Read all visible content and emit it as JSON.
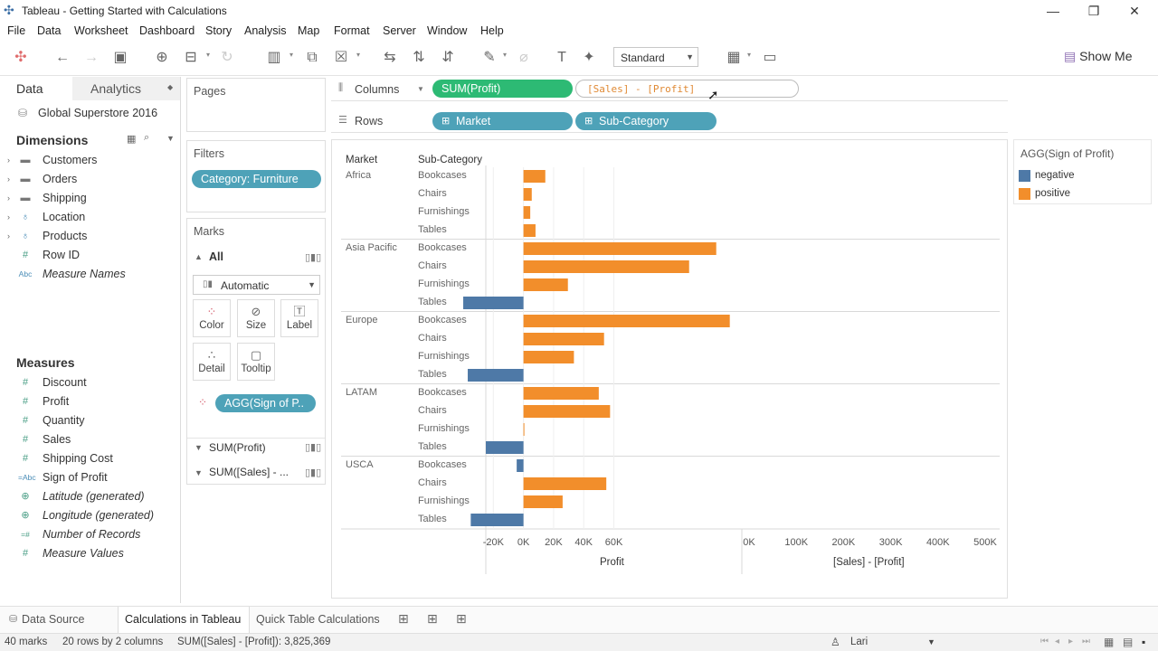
{
  "window": {
    "title": "Tableau - Getting Started with Calculations",
    "minimize": "—",
    "restore": "❐",
    "close": "✕"
  },
  "menu": [
    "File",
    "Data",
    "Worksheet",
    "Dashboard",
    "Story",
    "Analysis",
    "Map",
    "Format",
    "Server",
    "Window",
    "Help"
  ],
  "toolbar": {
    "fit_select": "Standard",
    "show_me": "Show Me"
  },
  "data_pane": {
    "tabs": {
      "data": "Data",
      "analytics": "Analytics"
    },
    "datasource": "Global Superstore 2016",
    "dimensions_title": "Dimensions",
    "dimensions": [
      {
        "label": "Customers",
        "icon": "folder-icon",
        "expand": "›"
      },
      {
        "label": "Orders",
        "icon": "folder-icon",
        "expand": "›"
      },
      {
        "label": "Shipping",
        "icon": "folder-icon",
        "expand": "›"
      },
      {
        "label": "Location",
        "icon": "hierarchy-icon",
        "expand": "›"
      },
      {
        "label": "Products",
        "icon": "hierarchy-icon",
        "expand": "›"
      },
      {
        "label": "Row ID",
        "icon": "hash-icon",
        "expand": ""
      },
      {
        "label": "Measure Names",
        "icon": "abc-icon",
        "expand": ""
      }
    ],
    "measures_title": "Measures",
    "measures": [
      {
        "label": "Discount",
        "icon": "hash-icon"
      },
      {
        "label": "Profit",
        "icon": "hash-icon"
      },
      {
        "label": "Quantity",
        "icon": "hash-icon"
      },
      {
        "label": "Sales",
        "icon": "hash-icon"
      },
      {
        "label": "Shipping Cost",
        "icon": "hash-icon"
      },
      {
        "label": "Sign of Profit",
        "icon": "calc-abc-icon"
      },
      {
        "label": "Latitude (generated)",
        "icon": "globe-icon"
      },
      {
        "label": "Longitude (generated)",
        "icon": "globe-icon"
      },
      {
        "label": "Number of Records",
        "icon": "calc-hash-icon"
      },
      {
        "label": "Measure Values",
        "icon": "hash-icon"
      }
    ]
  },
  "cards": {
    "pages_title": "Pages",
    "filters_title": "Filters",
    "filter_pill": "Category: Furniture",
    "marks_title": "Marks",
    "marks_all": "All",
    "mark_type": "Automatic",
    "mark_buttons": [
      {
        "label": "Color",
        "icon": "color-dots-icon"
      },
      {
        "label": "Size",
        "icon": "size-icon"
      },
      {
        "label": "Label",
        "icon": "label-icon"
      },
      {
        "label": "Detail",
        "icon": "detail-icon"
      },
      {
        "label": "Tooltip",
        "icon": "tooltip-icon"
      }
    ],
    "color_pill": "AGG(Sign of P..",
    "marks_sections": [
      "SUM(Profit)",
      "SUM([Sales] - ..."
    ]
  },
  "shelves": {
    "columns_label": "Columns",
    "rows_label": "Rows",
    "columns_pill": "SUM(Profit)",
    "columns_edit": "[Sales] - [Profit]",
    "rows_pills": [
      "Market",
      "Sub-Category"
    ]
  },
  "view": {
    "col_header_market": "Market",
    "col_header_subcat": "Sub-Category",
    "axis1_title": "Profit",
    "axis2_title": "[Sales] - [Profit]"
  },
  "chart_data": {
    "type": "bar",
    "markets": [
      "Africa",
      "Asia Pacific",
      "Europe",
      "LATAM",
      "USCA"
    ],
    "subcategories": [
      "Bookcases",
      "Chairs",
      "Furnishings",
      "Tables"
    ],
    "profit_series": {
      "name": "Profit",
      "values": [
        14500,
        5500,
        4500,
        8000,
        128000,
        110000,
        29500,
        -40000,
        137000,
        53500,
        33500,
        -37000,
        50000,
        57500,
        500,
        -25000,
        -4500,
        55000,
        26000,
        -35000
      ],
      "xlim": [
        -25000,
        145000
      ],
      "ticks": [
        -20000,
        0,
        20000,
        40000,
        60000
      ],
      "tick_labels": [
        "-20K",
        "0K",
        "20K",
        "40K",
        "60K"
      ]
    },
    "sales_minus_profit_series": {
      "name": "[Sales] - [Profit]",
      "values": [],
      "ticks": [
        0,
        100000,
        200000,
        300000,
        400000,
        500000
      ],
      "tick_labels": [
        "0K",
        "100K",
        "200K",
        "300K",
        "400K",
        "500K"
      ]
    },
    "color_legend_title": "AGG(Sign of Profit)",
    "legend": [
      {
        "name": "negative",
        "color": "#4e79a7"
      },
      {
        "name": "positive",
        "color": "#f28e2b"
      }
    ]
  },
  "tabs": {
    "data_source": "Data Source",
    "sheets": [
      "Calculations in Tableau",
      "Quick Table Calculations"
    ]
  },
  "status": {
    "marks": "40 marks",
    "rows_cols": "20 rows by 2 columns",
    "sum": "SUM([Sales] - [Profit]): 3,825,369",
    "user": "Lari"
  }
}
